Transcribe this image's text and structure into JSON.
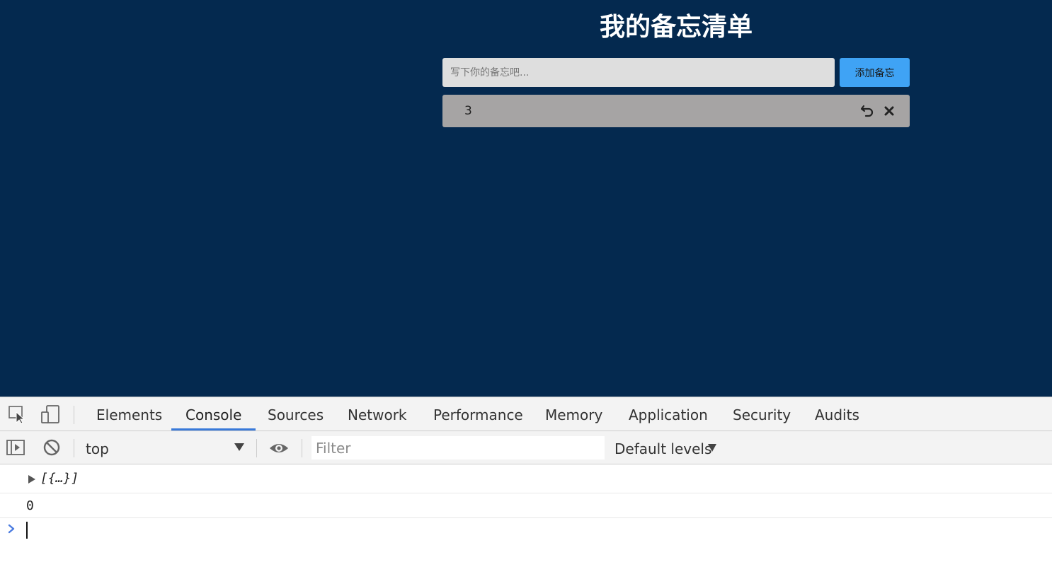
{
  "app": {
    "title": "我的备忘清单",
    "input_placeholder": "写下你的备忘吧...",
    "add_button": "添加备忘",
    "memos": [
      {
        "text": "3"
      }
    ],
    "colors": {
      "background": "#04294f",
      "accent": "#3fa3f5",
      "memo_bg": "#a6a4a4"
    }
  },
  "devtools": {
    "tabs": [
      "Elements",
      "Console",
      "Sources",
      "Network",
      "Performance",
      "Memory",
      "Application",
      "Security",
      "Audits"
    ],
    "active_tab": "Console",
    "toolbar": {
      "context": "top",
      "filter_placeholder": "Filter",
      "levels": "Default levels"
    },
    "console_messages": [
      {
        "type": "object",
        "text": "[{…}]"
      },
      {
        "type": "number",
        "text": "0"
      }
    ],
    "icons": [
      "inspect-element-icon",
      "device-toolbar-icon",
      "sidebar-toggle-icon",
      "clear-console-icon",
      "live-expression-eye-icon",
      "prompt-chevron-icon"
    ]
  }
}
